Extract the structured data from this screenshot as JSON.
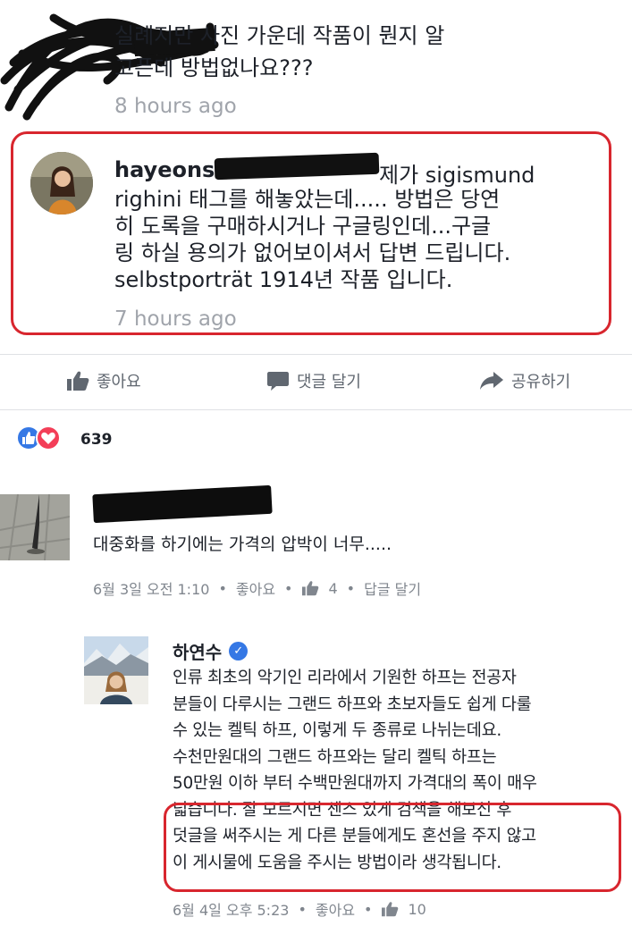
{
  "comment1": {
    "text": "실례지만 사진 가운데 작품이 뭔지 알\n고픈데 방법없나요???",
    "time": "8 hours ago"
  },
  "comment2": {
    "username": "hayeonsoo",
    "mention_tail": "제가 sigismund",
    "body": "righini 태그를 해놓았는데..... 방법은 당연\n히 도록을 구매하시거나 구글링인데...구글\n링 하실 용의가 없어보이셔서 답변 드립니다.\nselbstporträt 1914년 작품 입니다.",
    "time": "7 hours ago"
  },
  "actions": {
    "like": "좋아요",
    "comment": "댓글 달기",
    "share": "공유하기"
  },
  "reactions": {
    "count": "639"
  },
  "comment3": {
    "text": "대중화를 하기에는 가격의 압박이 너무.....",
    "time": "6월 3일 오전 1:10",
    "like": "좋아요",
    "like_count": "4",
    "reply": "답글 달기"
  },
  "reply": {
    "name": "하연수",
    "body": "인류 최초의 악기인 리라에서 기원한 하프는 전공자\n분들이 다루시는 그랜드 하프와 초보자들도 쉽게 다룰\n수 있는 켈틱 하프, 이렇게 두 종류로 나뉘는데요.\n수천만원대의 그랜드 하프와는 달리 켈틱 하프는\n50만원 이하 부터 수백만원대까지 가격대의 폭이 매우\n넓습니다. 잘 모르시면 센스 있게 검색을 해보신 후\n덧글을 써주시는 게 다른 분들에게도 혼선을 주지 않고\n이 게시물에 도움을 주시는 방법이라 생각됩니다.",
    "time": "6월 4일 오후 5:23",
    "like": "좋아요",
    "like_count": "10"
  },
  "colors": {
    "highlight_red": "#d8262e",
    "facebook_blue": "#3578e5",
    "love_red": "#f33e58",
    "meta_gray": "#80868e"
  },
  "icons": [
    "thumbs-up-icon",
    "comment-bubble-icon",
    "share-arrow-icon",
    "like-reaction-icon",
    "love-reaction-icon",
    "verified-badge-icon"
  ]
}
